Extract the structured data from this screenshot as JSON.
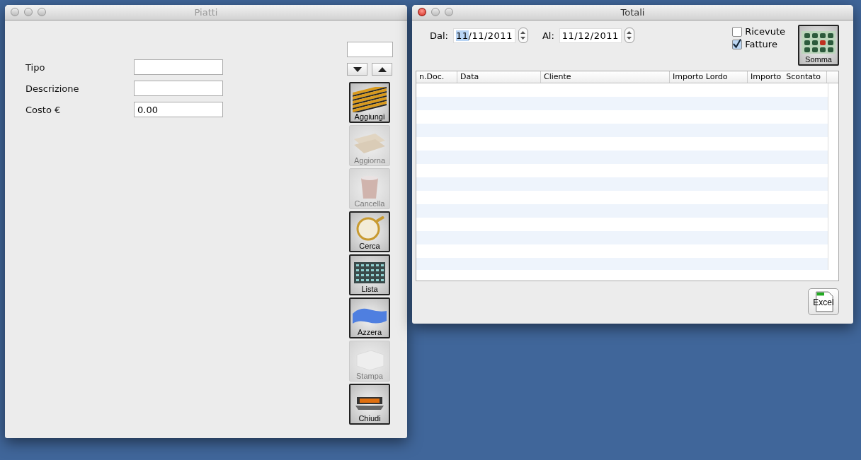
{
  "piatti": {
    "title": "Piatti",
    "fields": [
      {
        "label": "Tipo"
      },
      {
        "label": "Descrizione"
      },
      {
        "label": "Costo €",
        "value": "0.00"
      }
    ],
    "buttons": [
      {
        "kind": "add",
        "label": "Aggiungi",
        "disabled": false
      },
      {
        "kind": "update",
        "label": "Aggiorna",
        "disabled": true
      },
      {
        "kind": "delete",
        "label": "Cancella",
        "disabled": true
      },
      {
        "kind": "search",
        "label": "Cerca",
        "disabled": false
      },
      {
        "kind": "list",
        "label": "Lista",
        "disabled": false
      },
      {
        "kind": "reset",
        "label": "Azzera",
        "disabled": false
      },
      {
        "kind": "print",
        "label": "Stampa",
        "disabled": true
      },
      {
        "kind": "exit",
        "label": "Chiudi",
        "disabled": false
      }
    ]
  },
  "totali": {
    "title": "Totali",
    "dates": [
      {
        "label": "Dal:",
        "parts": [
          {
            "text": "11",
            "selected": true
          },
          {
            "text": "/11/2011",
            "selected": false
          }
        ]
      },
      {
        "label": "Al:",
        "parts": [
          {
            "text": "11/12/2011",
            "selected": false
          }
        ]
      }
    ],
    "checkboxes": [
      {
        "label": "Ricevute",
        "checked": false
      },
      {
        "label": "Fatture",
        "checked": true
      }
    ],
    "sum_button": "Somma",
    "table": {
      "columns": [
        "n.Doc.",
        "Data",
        "Cliente",
        "Importo Lordo",
        "Importo  Scontato"
      ]
    },
    "excel_button": "Excel"
  }
}
